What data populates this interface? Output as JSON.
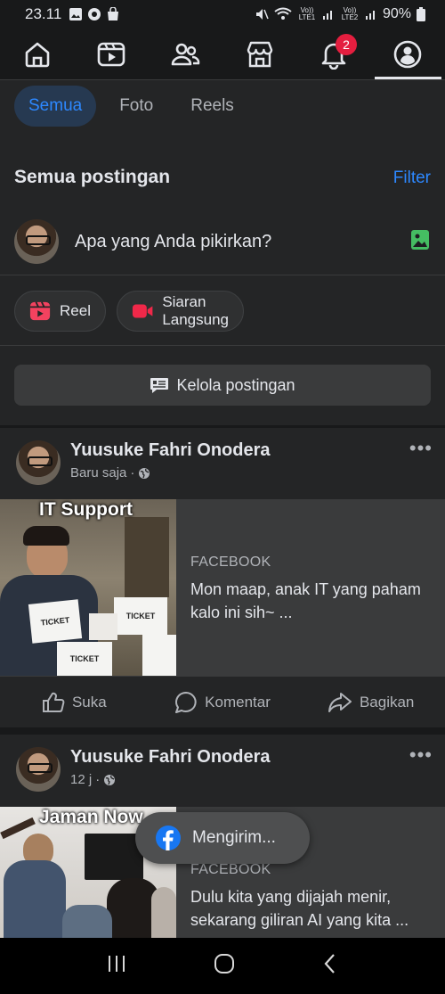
{
  "status_bar": {
    "time": "23.11",
    "lte1": "Vo)) LTE1",
    "lte2": "Vo)) LTE2",
    "battery": "90%"
  },
  "nav": {
    "items": [
      "home-icon",
      "video-icon",
      "friends-icon",
      "marketplace-icon",
      "bell-icon",
      "profile-icon"
    ],
    "notif_count": "2",
    "active": "profile-icon"
  },
  "filters": {
    "chips": [
      "Semua",
      "Foto",
      "Reels"
    ],
    "active": "Semua"
  },
  "posts_section": {
    "heading": "Semua postingan",
    "filter_label": "Filter"
  },
  "composer": {
    "placeholder": "Apa yang Anda pikirkan?"
  },
  "quick_actions": {
    "reel_label": "Reel",
    "live_label_line1": "Siaran",
    "live_label_line2": "Langsung"
  },
  "manage": {
    "label": "Kelola postingan"
  },
  "posts": [
    {
      "author": "Yuusuke Fahri Onodera",
      "time": "Baru saja",
      "thumb_caption": "IT Support",
      "ticket_label": "TICKET",
      "source": "FACEBOOK",
      "title": "Mon maap, anak IT yang paham kalo ini sih~ ..."
    },
    {
      "author": "Yuusuke Fahri Onodera",
      "time": "12 j",
      "thumb_caption": "Jaman Now",
      "source": "FACEBOOK",
      "title": "Dulu kita yang dijajah menir, sekarang giliran AI yang kita ..."
    }
  ],
  "post_actions": {
    "like": "Suka",
    "comment": "Komentar",
    "share": "Bagikan"
  },
  "toast": {
    "label": "Mengirim..."
  },
  "colors": {
    "background": "#242526",
    "accent_blue": "#2d88ff",
    "badge_red": "#e41e3f"
  }
}
